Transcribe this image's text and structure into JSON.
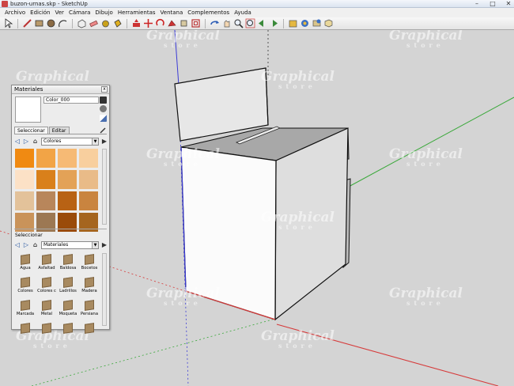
{
  "window": {
    "title": "buzon-urnas.skp - SketchUp",
    "controls": [
      "–",
      "□",
      "✕"
    ]
  },
  "menu": [
    "Archivo",
    "Edición",
    "Ver",
    "Cámara",
    "Dibujo",
    "Herramientas",
    "Ventana",
    "Complementos",
    "Ayuda"
  ],
  "toolbar": {
    "icons": [
      "select-icon",
      "pencil-icon",
      "rectangle-icon",
      "circle-icon",
      "arc-icon",
      "make-component-icon",
      "eraser-icon",
      "tape-measure-icon",
      "paint-bucket-icon",
      "push-pull-icon",
      "move-icon",
      "rotate-icon",
      "follow-me-icon",
      "scale-icon",
      "offset-icon",
      "orbit-icon",
      "pan-icon",
      "zoom-icon",
      "zoom-extents-icon",
      "previous-view-icon",
      "next-view-icon",
      "get-models-icon",
      "share-model-icon",
      "add-location-icon",
      "components-icon"
    ]
  },
  "watermark": {
    "text": "Graphical",
    "sub": "store"
  },
  "materials": {
    "title": "Materiales",
    "close_label": "x",
    "current_name": "Color_000",
    "tabs": [
      "Seleccionar",
      "Editar"
    ],
    "collection": "Colores",
    "swatch_colors": [
      "#f08a12",
      "#f2a446",
      "#f6ba75",
      "#f8cf9e",
      "#fce1c6",
      "#d9801b",
      "#e3a257",
      "#e9bb88",
      "#e3c29a",
      "#b8865b",
      "#b86214",
      "#c9843f",
      "#c9935a",
      "#9c7853",
      "#9a4b0a",
      "#a5651f"
    ],
    "lower_title": "Seleccionar",
    "library": "Materiales",
    "library_items": [
      "Agua",
      "Asfaltad",
      "Baldosa",
      "Bocetos",
      "Colores",
      "Colores c",
      "Ladrillos",
      "Madera",
      "Marcada",
      "Metal",
      "Moqueta",
      "Persiana",
      "",
      "",
      "",
      ""
    ]
  },
  "colors": {
    "axis_red": "#d63a3a",
    "axis_green": "#3aa83a",
    "axis_blue": "#3a3ad6",
    "viewport_bg": "#d4d4d4"
  }
}
